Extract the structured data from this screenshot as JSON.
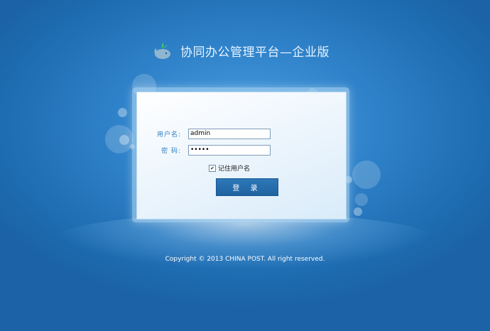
{
  "header": {
    "title": "协同办公管理平台—企业版",
    "logo_icon": "whale-icon"
  },
  "login": {
    "username_label": "用户名:",
    "username_value": "admin",
    "password_label": "密  码:",
    "password_value": "•••••",
    "remember_checked": true,
    "remember_label": "记住用户名",
    "submit_label": "登 录"
  },
  "footer": {
    "copyright": "Copyright © 2013 CHINA POST. All right reserved."
  },
  "colors": {
    "background": "#2f82c9",
    "label": "#2f7fc0",
    "button": "#2468a8"
  }
}
